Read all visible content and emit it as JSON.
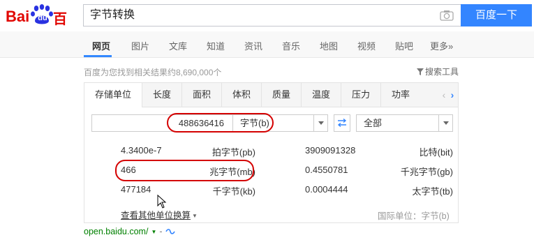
{
  "header": {
    "logo": {
      "bai": "Bai",
      "du": "du",
      "cn": "百度"
    },
    "search_query": "字节转换",
    "search_button": "百度一下",
    "camera_icon": "camera-icon"
  },
  "tabs": [
    {
      "label": "网页",
      "active": true
    },
    {
      "label": "图片"
    },
    {
      "label": "文库"
    },
    {
      "label": "知道"
    },
    {
      "label": "资讯"
    },
    {
      "label": "音乐"
    },
    {
      "label": "地图"
    },
    {
      "label": "视频"
    },
    {
      "label": "贴吧"
    },
    {
      "label": "更多»"
    }
  ],
  "result_count": "百度为您找到相关结果约8,690,000个",
  "search_tools": "搜索工具",
  "converter": {
    "unit_tabs": [
      "存储单位",
      "长度",
      "面积",
      "体积",
      "质量",
      "温度",
      "压力",
      "功率"
    ],
    "input_value": "488636416",
    "from_unit": "字节(b)",
    "to_unit": "全部",
    "results": [
      {
        "value": "4.3400e-7",
        "unit": "拍字节(pb)"
      },
      {
        "value": "3909091328",
        "unit": "比特(bit)"
      },
      {
        "value": "466",
        "unit": "兆字节(mb)"
      },
      {
        "value": "0.4550781",
        "unit": "千兆字节(gb)"
      },
      {
        "value": "477184",
        "unit": "千字节(kb)"
      },
      {
        "value": "0.0004444",
        "unit": "太字节(tb)"
      }
    ],
    "more_link": "查看其他单位换算",
    "intl_unit": "国际单位：字节(b)"
  },
  "result_url": "open.baidu.com/",
  "colors": {
    "brand_red": "#e10601",
    "brand_blue": "#3385ff",
    "highlight_ring": "#d40000",
    "url_green": "#008000"
  }
}
